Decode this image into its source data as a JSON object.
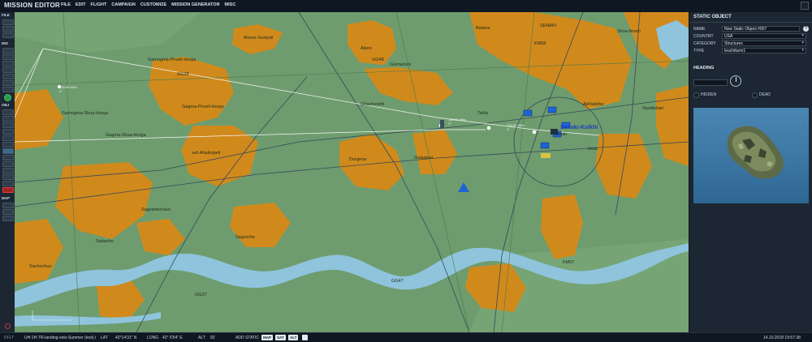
{
  "app": {
    "title": "MISSION EDITOR"
  },
  "menu": [
    "FILE",
    "EDIT",
    "FLIGHT",
    "CAMPAIGN",
    "CUSTOMIZE",
    "MISSION GENERATOR",
    "MISC"
  ],
  "left_toolbar": {
    "file_label": "FILE",
    "mis_label": "MIS",
    "obj_label": "OBJ",
    "map_label": "MAP"
  },
  "map": {
    "towns": [
      "Meore Guripuli",
      "Alioni",
      "Bataria",
      "SENAKI",
      "Shua-Nosiri",
      "Gamogma-Pirveli-Horga",
      "GG48",
      "Gvimarioni",
      "KM58",
      "Ghachonkhi",
      "Tekla",
      "Akhlatsihe",
      "Saodishari",
      "Gamogma-Shua-Horga",
      "Gagma-Pirveli-Horga",
      "Gagma-Shua-Horga",
      "Senaki-Kolkhi",
      "Nosiri",
      "Isula",
      "svh Ahalsopeli",
      "Durgena",
      "Golaskuri",
      "Sabazho",
      "Sagvamichavo",
      "Sagvichio",
      "Sachochuo",
      "GG37",
      "GG47",
      "KM57",
      "GG38"
    ],
    "waypoint_labels": [
      "130.50 MHz",
      "0°",
      "131.00 MHz",
      "3°",
      "130.00 MHz",
      "0°"
    ]
  },
  "panel": {
    "title": "STATIC OBJECT",
    "fields": [
      {
        "label": "NAME",
        "value": "New Static Object #007"
      },
      {
        "label": "COUNTRY",
        "value": "USA"
      },
      {
        "label": "CATEGORY",
        "value": "Structures"
      },
      {
        "label": "TYPE",
        "value": "leuchtturm1"
      }
    ],
    "help": "?",
    "heading_label": "HEADING",
    "hidden_label": "HIDDEN",
    "dead_label": "DEAD"
  },
  "status": {
    "mode": "DFLT",
    "mission_file": "UH-1H-TR-landing-solo-Summer (test).i",
    "lat_label": "LAT",
    "lat_value": "42°14'31\" N",
    "long_label": "LONG",
    "long_value": "42° 6'54\" E",
    "alt_label": "ALT",
    "alt_value": "92",
    "add_static": "ADD STATIC",
    "btn_map": "MAP",
    "btn_sat": "SAT",
    "btn_alt": "ALT",
    "datetime": "14.10.2018 19:57:38"
  },
  "colors": {
    "terrain": "#6e9c6e",
    "urban": "#d08a1c",
    "river": "#8fc4dc",
    "panel": "#1c2733"
  }
}
